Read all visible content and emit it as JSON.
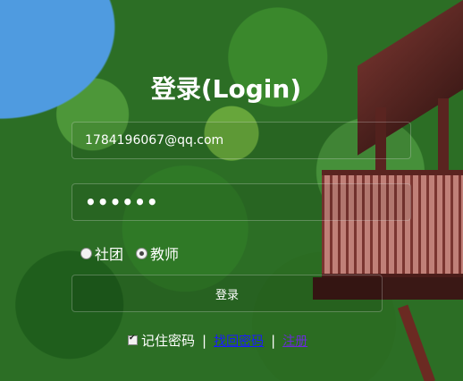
{
  "title": "登录(Login)",
  "email": {
    "value": "1784196067@qq.com"
  },
  "password": {
    "value": "••••••"
  },
  "roles": [
    {
      "label": "社团",
      "checked": false
    },
    {
      "label": "教师",
      "checked": true
    }
  ],
  "login_button": "登录",
  "remember": {
    "label": "记住密码",
    "checked": true
  },
  "separator": "|",
  "forgot_link": "找回密码",
  "register_link": "注册"
}
